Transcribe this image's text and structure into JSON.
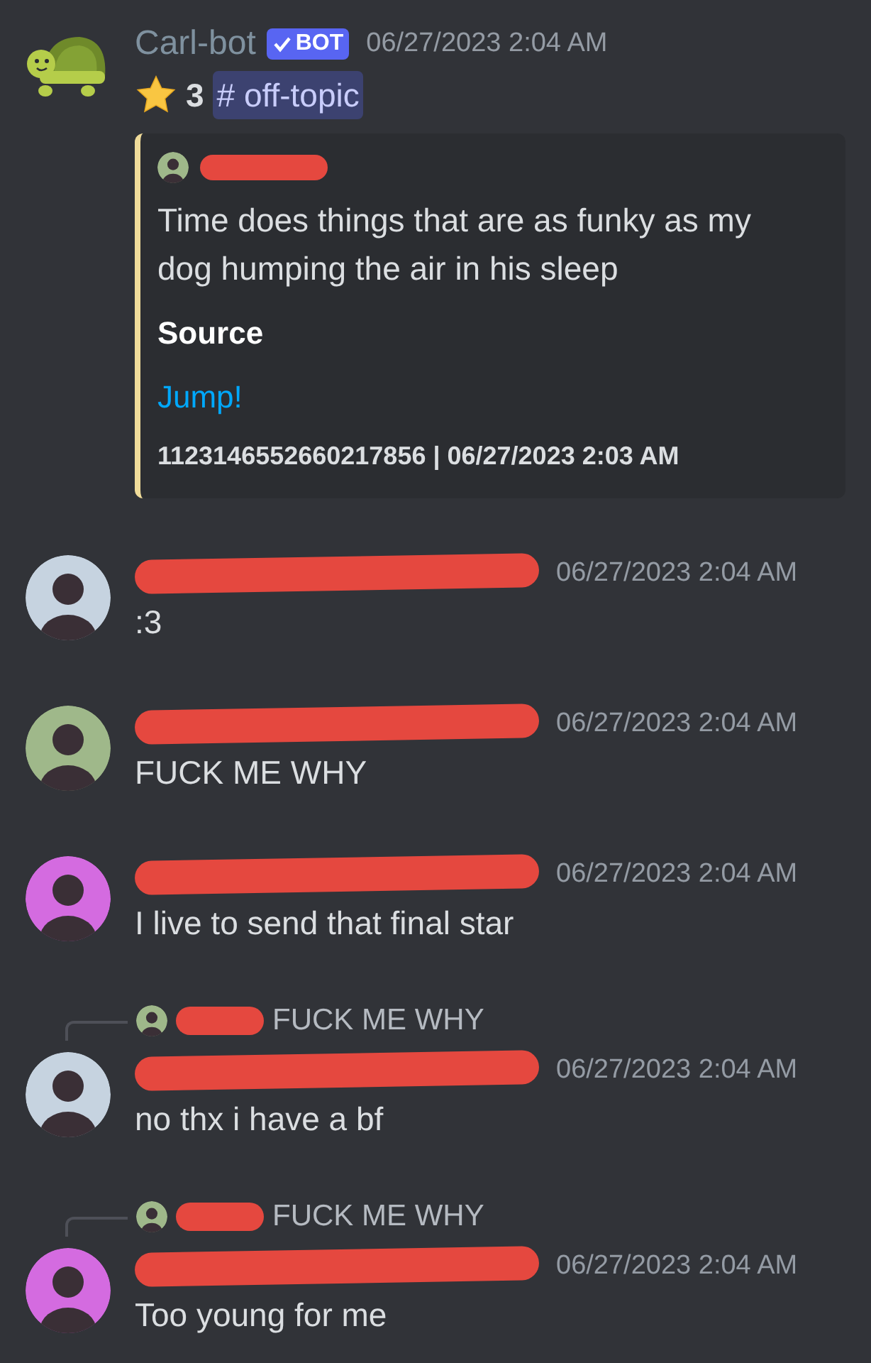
{
  "messages": [
    {
      "kind": "bot",
      "author": "Carl-bot",
      "badge": "BOT",
      "time": "06/27/2023 2:04 AM",
      "star_count": "3",
      "channel": "# off-topic",
      "embed": {
        "author": {
          "color": "#9fb88a",
          "redacted": true
        },
        "description": "Time does things that are as funky as my dog humping the air in his sleep",
        "field_name": "Source",
        "field_value": "Jump!",
        "footer": "1123146552660217856 | 06/27/2023 2:03 AM"
      }
    },
    {
      "kind": "user",
      "color": "#c6d3e0",
      "redacted": true,
      "time": "06/27/2023 2:04 AM",
      "text": ":3"
    },
    {
      "kind": "user",
      "color": "#9fb88a",
      "redacted": true,
      "time": "06/27/2023 2:04 AM",
      "text": "FUCK ME WHY"
    },
    {
      "kind": "user",
      "color": "#d46be0",
      "redacted": true,
      "time": "06/27/2023 2:04 AM",
      "text": "I live to send that final star"
    },
    {
      "kind": "user",
      "color": "#c6d3e0",
      "redacted": true,
      "time": "06/27/2023 2:04 AM",
      "text": "no thx i have a bf",
      "reply": {
        "color": "#9fb88a",
        "redacted": true,
        "text": "FUCK ME WHY"
      }
    },
    {
      "kind": "user",
      "color": "#d46be0",
      "redacted": true,
      "time": "06/27/2023 2:04 AM",
      "text": "Too young for me",
      "reply": {
        "color": "#9fb88a",
        "redacted": true,
        "text": "FUCK ME WHY"
      }
    }
  ]
}
